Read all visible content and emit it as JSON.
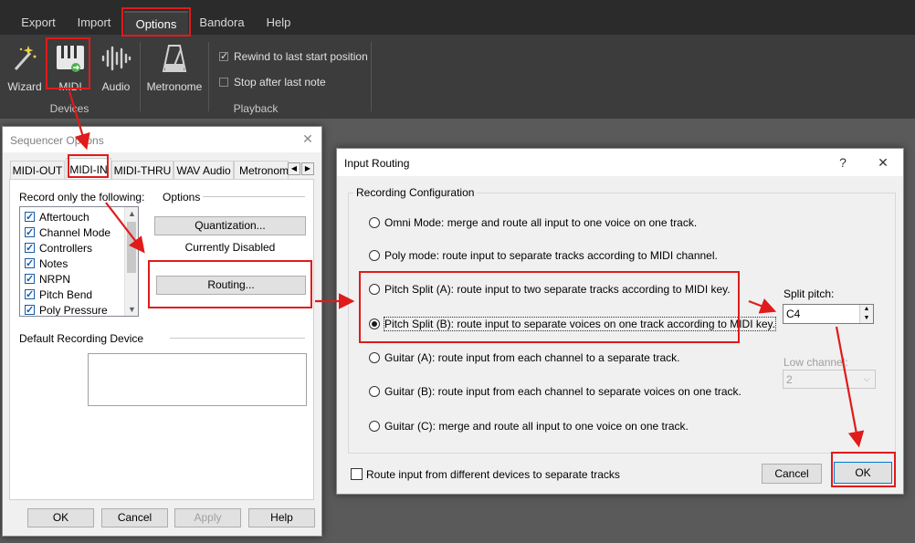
{
  "menubar": {
    "items": [
      "Export",
      "Import",
      "Options",
      "Bandora",
      "Help"
    ],
    "active": "Options"
  },
  "ribbon": {
    "devices": {
      "group_label": "Devices",
      "buttons": [
        "Wizard",
        "MIDI",
        "Audio"
      ]
    },
    "metronome_label": "Metronome",
    "playback": {
      "group_label": "Playback",
      "rewind_label": "Rewind to last start position",
      "rewind_checked": true,
      "stop_label": "Stop after last note",
      "stop_checked": false
    }
  },
  "sequencer_dialog": {
    "title": "Sequencer Options",
    "tabs": [
      "MIDI-OUT",
      "MIDI-IN",
      "MIDI-THRU",
      "WAV Audio",
      "Metronome"
    ],
    "selected_tab": "MIDI-IN",
    "record_label": "Record only the following:",
    "record_items": [
      "Aftertouch",
      "Channel Mode",
      "Controllers",
      "Notes",
      "NRPN",
      "Pitch Bend",
      "Poly Pressure"
    ],
    "options_label": "Options",
    "quantization_button": "Quantization...",
    "quantization_status": "Currently Disabled",
    "routing_button": "Routing...",
    "default_device_label": "Default Recording Device",
    "buttons": {
      "ok": "OK",
      "cancel": "Cancel",
      "apply": "Apply",
      "help": "Help"
    }
  },
  "routing_dialog": {
    "title": "Input Routing",
    "help_glyph": "?",
    "group_label": "Recording Configuration",
    "options": [
      "Omni Mode: merge and route all input to one voice on one track.",
      "Poly mode: route input to separate tracks according to MIDI channel.",
      "Pitch Split (A): route input to two separate tracks according to MIDI key.",
      "Pitch Split (B): route input to separate voices on one track according to MIDI key.",
      "Guitar (A): route input from each channel to a separate track.",
      "Guitar (B): route input from each channel to separate voices on one track.",
      "Guitar (C): merge and route all input to one voice on one track."
    ],
    "selected_option_index": 3,
    "split_pitch_label": "Split pitch:",
    "split_pitch_value": "C4",
    "low_channel_label": "Low channel:",
    "low_channel_value": "2",
    "route_devices_label": "Route input from different devices to separate tracks",
    "route_devices_checked": false,
    "cancel_button": "Cancel",
    "ok_button": "OK"
  },
  "colors": {
    "highlight_red": "#e01b1b",
    "ribbon_bg": "#3c3c3c",
    "menubar_bg": "#2b2b2b",
    "dialog_bg": "#f0f0f0",
    "checkbox_blue": "#1a5aa8"
  },
  "icons": [
    "magic-wand-icon",
    "piano-keys-icon",
    "audio-waveform-icon",
    "metronome-icon",
    "close-icon",
    "help-icon",
    "scroll-up-icon",
    "scroll-down-icon",
    "tab-scroll-left-icon",
    "tab-scroll-right-icon",
    "spin-up-icon",
    "spin-down-icon",
    "dropdown-arrow-icon"
  ]
}
